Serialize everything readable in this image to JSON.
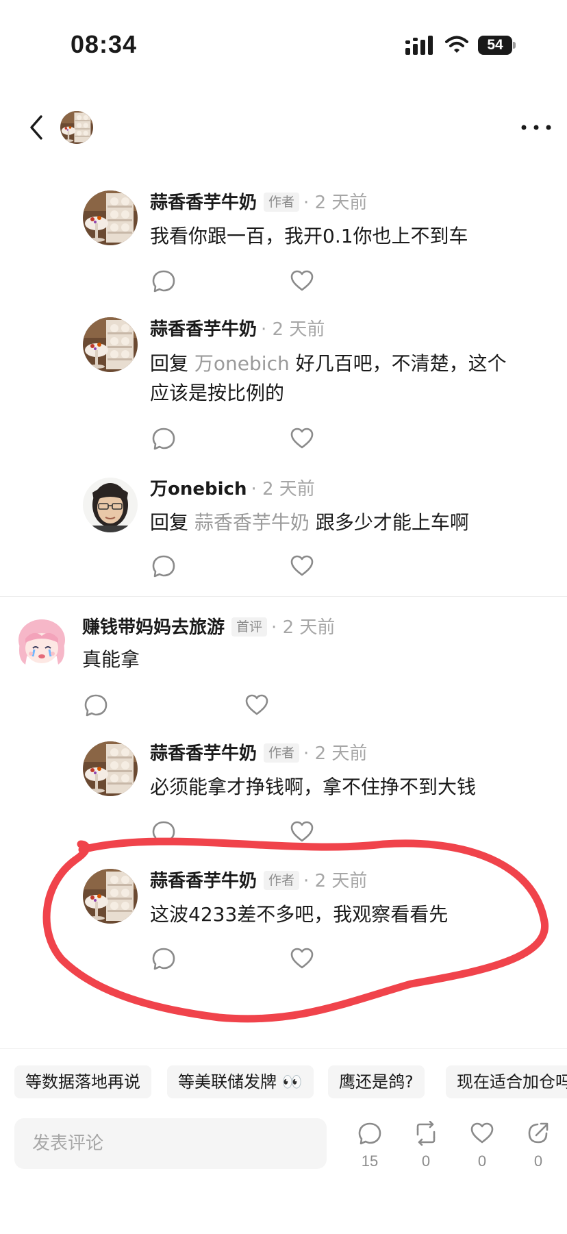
{
  "status_bar": {
    "time": "08:34",
    "battery": "54"
  },
  "header": {
    "back_icon": "chevron-left-icon",
    "more_icon": "more-dots-icon"
  },
  "comments": [
    {
      "author": "蒜香香芋牛奶",
      "badge": "作者",
      "time": "2 天前",
      "text": "我看你跟一百，我开0.1你也上不到车"
    },
    {
      "author": "蒜香香芋牛奶",
      "time": "2 天前",
      "reply_prefix": "回复",
      "reply_to": "万onebich",
      "text_line1": " 好几百吧，不清楚，这个",
      "text_line2": "应该是按比例的"
    },
    {
      "author": "万onebich",
      "time": "2 天前",
      "reply_prefix": "回复",
      "reply_to": "蒜香香芋牛奶",
      "text": " 跟多少才能上车啊"
    },
    {
      "author": "赚钱带妈妈去旅游",
      "badge": "首评",
      "time": "2 天前",
      "text": "真能拿"
    },
    {
      "author": "蒜香香芋牛奶",
      "badge": "作者",
      "time": "2 天前",
      "text": "必须能拿才挣钱啊，拿不住挣不到大钱"
    },
    {
      "author": "蒜香香芋牛奶",
      "badge": "作者",
      "time": "2 天前",
      "text": "这波4233差不多吧，我观察看看先"
    }
  ],
  "separator": "·",
  "suggestions": [
    "等数据落地再说",
    "等美联储发牌 👀",
    "鹰还是鸽?",
    "现在适合加仓吗"
  ],
  "bottom_bar": {
    "input_placeholder": "发表评论",
    "comment_count": "15",
    "repost_count": "0",
    "like_count": "0",
    "share_count": "0"
  },
  "colors": {
    "annotation": "#f0434b",
    "muted": "#a6a6a6",
    "chip_bg": "#f5f5f5"
  }
}
